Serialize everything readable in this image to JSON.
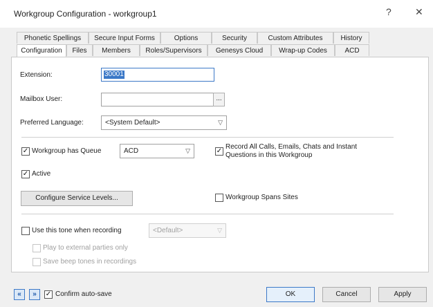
{
  "window": {
    "title": "Workgroup Configuration - workgroup1",
    "help_glyph": "?",
    "close_glyph": "✕"
  },
  "tabs": {
    "row1": [
      "Phonetic Spellings",
      "Secure Input Forms",
      "Options",
      "Security",
      "Custom Attributes",
      "History"
    ],
    "row2": [
      "Configuration",
      "Files",
      "Members",
      "Roles/Supervisors",
      "Genesys Cloud",
      "Wrap-up Codes",
      "ACD"
    ],
    "active": "Configuration"
  },
  "form": {
    "extension_label": "Extension:",
    "extension_value": "30001",
    "mailbox_label": "Mailbox User:",
    "mailbox_value": "",
    "browse_label": "...",
    "language_label": "Preferred Language:",
    "language_value": "<System Default>",
    "queue_label": "Workgroup has Queue",
    "queue_checked": true,
    "queue_type": "ACD",
    "record_label_line1": "Record All Calls, Emails, Chats and Instant",
    "record_label_line2": "Questions in this Workgroup",
    "record_checked": true,
    "active_label": "Active",
    "active_checked": true,
    "service_levels_button": "Configure Service Levels...",
    "spans_sites_label": "Workgroup Spans Sites",
    "spans_sites_checked": false,
    "tone_label": "Use this tone when recording",
    "tone_checked": false,
    "tone_value": "<Default>",
    "play_external_label": "Play to external parties only",
    "save_beep_label": "Save beep tones in recordings"
  },
  "footer": {
    "prev_glyph": "«",
    "next_glyph": "»",
    "confirm_label": "Confirm auto-save",
    "confirm_checked": true,
    "ok_label": "OK",
    "cancel_label": "Cancel",
    "apply_label": "Apply"
  },
  "colors": {
    "accent": "#3b78c7",
    "selection": "#3b78c7"
  }
}
